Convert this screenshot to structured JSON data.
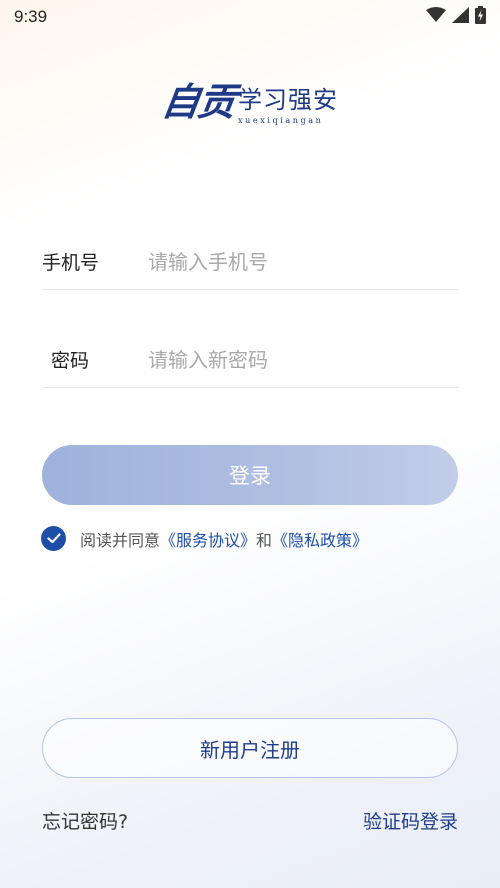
{
  "status_bar": {
    "time": "9:39",
    "icons": [
      "wifi-icon",
      "signal-icon",
      "battery-charging-icon"
    ]
  },
  "logo": {
    "script_text": "自贡",
    "title": "学习强安",
    "pinyin": "xuexiqiangan",
    "color": "#1e3a86"
  },
  "form": {
    "phone": {
      "label": "手机号",
      "placeholder": "请输入手机号",
      "value": ""
    },
    "password": {
      "label": "密码",
      "placeholder": "请输入新密码",
      "value": ""
    }
  },
  "login_button": {
    "label": "登录",
    "color": "#a9b9df"
  },
  "agreement": {
    "checked": true,
    "prefix": "阅读并同意",
    "service_link": "《服务协议》",
    "and": "和",
    "privacy_link": "《隐私政策》",
    "accent": "#1d4ea8"
  },
  "register_button": {
    "label": "新用户注册"
  },
  "footer": {
    "forgot_password": "忘记密码?",
    "code_login": "验证码登录"
  }
}
